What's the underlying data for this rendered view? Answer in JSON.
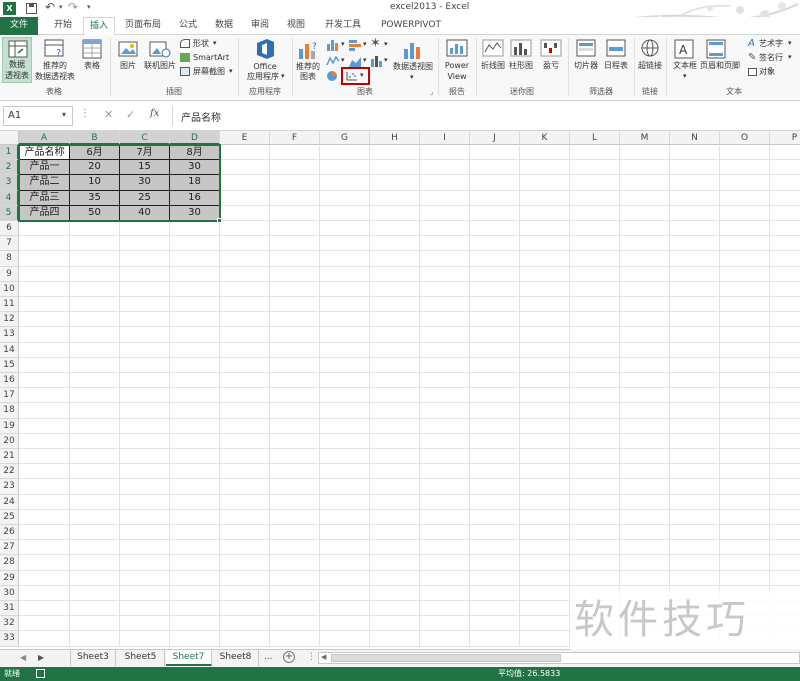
{
  "window": {
    "title": "excel2013 - Excel"
  },
  "tabs": [
    "文件",
    "开始",
    "插入",
    "页面布局",
    "公式",
    "数据",
    "审阅",
    "视图",
    "开发工具",
    "POWERPIVOT"
  ],
  "ribbon": {
    "groups": {
      "tables": "表格",
      "illustrations": "插图",
      "apps": "应用程序",
      "charts": "图表",
      "reports": "报告",
      "sparklines": "迷你图",
      "filters": "筛选器",
      "links": "链接",
      "text": "文本"
    },
    "pivot_line1": "数据",
    "pivot_line2": "透视表",
    "rec_pivot_line1": "推荐的",
    "rec_pivot_line2": "数据透视表",
    "table": "表格",
    "pictures": "图片",
    "online_pictures": "联机图片",
    "shapes": "形状",
    "smartart": "SmartArt",
    "screenshot": "屏幕截图",
    "office_line1": "Office",
    "office_line2": "应用程序",
    "rec_chart_line1": "推荐的",
    "rec_chart_line2": "图表",
    "pivot_chart": "数据透视图",
    "power_line1": "Power",
    "power_line2": "View",
    "line": "折线图",
    "column": "柱形图",
    "winloss": "盈亏",
    "slicer": "切片器",
    "timeline": "日程表",
    "hyperlink": "超链接",
    "textbox": "文本框",
    "header_footer": "页眉和页脚",
    "wordart": "艺术字",
    "signature": "签名行",
    "object": "对象"
  },
  "formula_bar": {
    "name_box": "A1",
    "fx": "fx",
    "content": "产品名称"
  },
  "columns": [
    "A",
    "B",
    "C",
    "D",
    "E",
    "F",
    "G",
    "H",
    "I",
    "J",
    "K",
    "L",
    "M",
    "N",
    "O",
    "P"
  ],
  "rows": [
    "1",
    "2",
    "3",
    "4",
    "5",
    "6",
    "7",
    "8",
    "9",
    "10",
    "11",
    "12",
    "13",
    "14",
    "15",
    "16",
    "17",
    "18",
    "19",
    "20",
    "21",
    "22",
    "23",
    "24",
    "25",
    "26",
    "27",
    "28",
    "29",
    "30",
    "31",
    "32",
    "33"
  ],
  "table": {
    "header": [
      "产品名称",
      "6月",
      "7月",
      "8月"
    ],
    "rows": [
      [
        "产品一",
        "20",
        "15",
        "30"
      ],
      [
        "产品二",
        "10",
        "30",
        "18"
      ],
      [
        "产品三",
        "35",
        "25",
        "16"
      ],
      [
        "产品四",
        "50",
        "40",
        "30"
      ]
    ]
  },
  "sheets": [
    "Sheet3",
    "Sheet5",
    "Sheet7",
    "Sheet8"
  ],
  "sheet_more": "...",
  "status": {
    "ready": "就绪",
    "average": "平均值: 26.5833"
  },
  "watermark": "软件技巧",
  "colors": {
    "excel_green": "#217346",
    "selection": "#c6c6c6",
    "highlight_box": "#c00000"
  }
}
